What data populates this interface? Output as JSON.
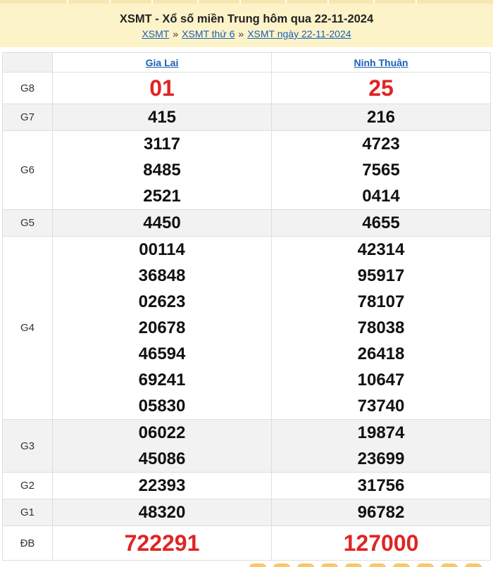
{
  "header": {
    "title": "XSMT - Xổ số miền Trung hôm qua 22-11-2024",
    "crumbs": [
      "XSMT",
      "XSMT thứ 6",
      "XSMT ngày 22-11-2024"
    ],
    "separator": "»"
  },
  "columns": [
    "Gia Lai",
    "Ninh Thuận"
  ],
  "rows": [
    {
      "label": "G8",
      "shade": false,
      "style": "red-big",
      "col1": [
        "01"
      ],
      "col2": [
        "25"
      ]
    },
    {
      "label": "G7",
      "shade": true,
      "style": "num",
      "col1": [
        "415"
      ],
      "col2": [
        "216"
      ]
    },
    {
      "label": "G6",
      "shade": false,
      "style": "num",
      "col1": [
        "3117",
        "8485",
        "2521"
      ],
      "col2": [
        "4723",
        "7565",
        "0414"
      ]
    },
    {
      "label": "G5",
      "shade": true,
      "style": "num",
      "col1": [
        "4450"
      ],
      "col2": [
        "4655"
      ]
    },
    {
      "label": "G4",
      "shade": false,
      "style": "num",
      "col1": [
        "00114",
        "36848",
        "02623",
        "20678",
        "46594",
        "69241",
        "05830"
      ],
      "col2": [
        "42314",
        "95917",
        "78107",
        "78038",
        "26418",
        "10647",
        "73740"
      ]
    },
    {
      "label": "G3",
      "shade": true,
      "style": "num",
      "col1": [
        "06022",
        "45086"
      ],
      "col2": [
        "19874",
        "23699"
      ]
    },
    {
      "label": "G2",
      "shade": false,
      "style": "num",
      "col1": [
        "22393"
      ],
      "col2": [
        "31756"
      ]
    },
    {
      "label": "G1",
      "shade": true,
      "style": "num",
      "col1": [
        "48320"
      ],
      "col2": [
        "96782"
      ]
    },
    {
      "label": "ĐB",
      "shade": false,
      "style": "red-db",
      "col1": [
        "722291"
      ],
      "col2": [
        "127000"
      ]
    }
  ],
  "colors": {
    "accent_red": "#e02424",
    "link_blue": "#1a5fb4",
    "header_bg": "#fdf3c9"
  }
}
